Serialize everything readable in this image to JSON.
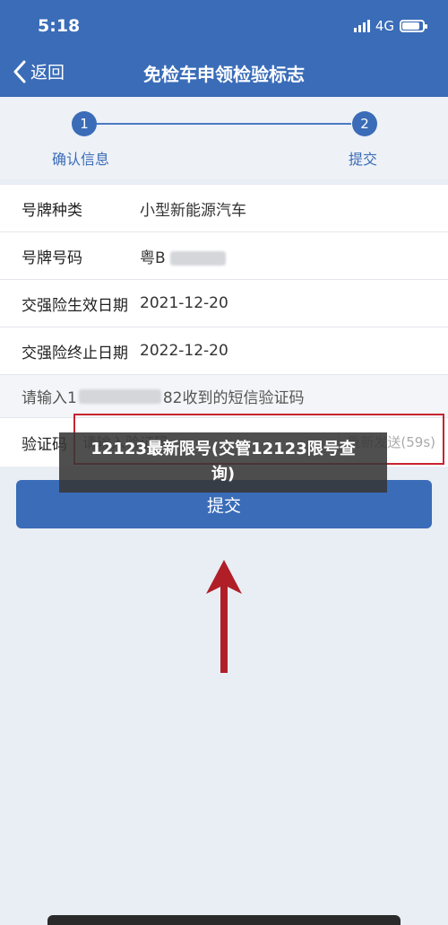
{
  "status_bar": {
    "time": "5:18",
    "network": "4G",
    "battery_level": 0.8
  },
  "nav": {
    "back_label": "返回",
    "title": "免检车申领检验标志"
  },
  "steps": [
    {
      "number": "1",
      "label": "确认信息"
    },
    {
      "number": "2",
      "label": "提交"
    }
  ],
  "form": {
    "plate_type": {
      "label": "号牌种类",
      "value": "小型新能源汽车"
    },
    "plate_number": {
      "label": "号牌号码",
      "value": "粤B"
    },
    "insurance_start": {
      "label": "交强险生效日期",
      "value": "2021-12-20"
    },
    "insurance_end": {
      "label": "交强险终止日期",
      "value": "2022-12-20"
    },
    "sms_hint": {
      "prefix": "请输入1",
      "suffix": "82收到的短信验证码"
    },
    "code": {
      "label": "验证码",
      "placeholder": "请输入验证码",
      "resend": "重新发送(59s)"
    }
  },
  "submit_label": "提交",
  "overlay": {
    "line1": "12123最新限号(交管12123限号查",
    "line2": "询)"
  },
  "colors": {
    "primary": "#3a6cb8",
    "highlight": "#c8242f",
    "arrow": "#b01f28"
  }
}
